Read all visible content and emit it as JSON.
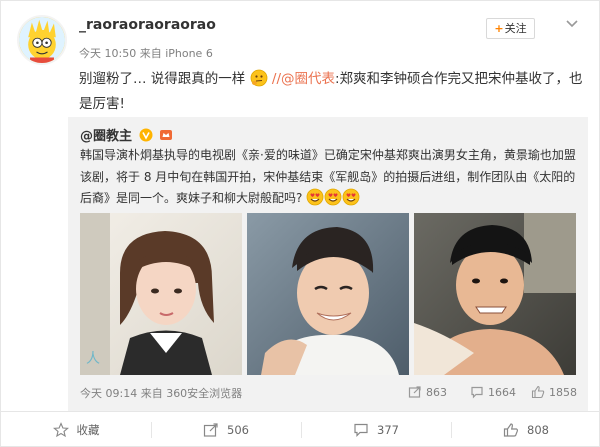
{
  "post": {
    "username": "_raoraoraoraorao",
    "meta": "今天 10:50 来自 iPhone 6",
    "follow_label": "关注",
    "text_part1": "别遛粉了… 说得跟真的一样",
    "text_sep": "//",
    "mention": "@圈代表",
    "text_part2": ":郑爽和李钟硕合作完又把宋仲基收了，也是厉害!"
  },
  "repost": {
    "author": "@圈教主",
    "text": "韩国导演朴炯基执导的电视剧《亲·爱的味道》已确定宋仲基郑爽出演男女主角，黄景瑜也加盟该剧，将于 8 月中旬在韩国开拍，宋仲基结束《军舰岛》的拍摄后进组，制作团队由《太阳的后裔》是同一个。爽妹子和柳大尉般配吗?",
    "meta": "今天 09:14 来自 360安全浏览器",
    "stats": {
      "reposts": "863",
      "comments": "1664",
      "likes": "1858"
    },
    "photos": [
      "photo-actress",
      "photo-actor-smiling",
      "photo-actor-selfie"
    ]
  },
  "actions": {
    "collect": "收藏",
    "repost": "506",
    "comment": "377",
    "like": "808"
  },
  "colors": {
    "accent": "#ff8200",
    "link": "#eb7350",
    "repost_bg": "#f2f2f2",
    "meta_text": "#808080"
  }
}
